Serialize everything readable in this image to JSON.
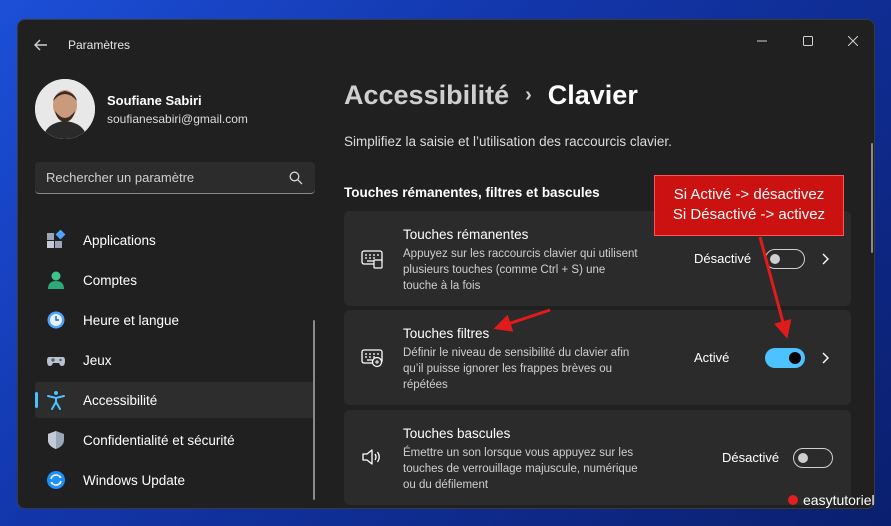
{
  "window": {
    "title": "Paramètres"
  },
  "user": {
    "name": "Soufiane Sabiri",
    "email": "soufianesabiri@gmail.com"
  },
  "search": {
    "placeholder": "Rechercher un paramètre"
  },
  "sidebar": {
    "items": [
      {
        "label": "Applications",
        "icon": "apps-icon"
      },
      {
        "label": "Comptes",
        "icon": "accounts-icon"
      },
      {
        "label": "Heure et langue",
        "icon": "time-language-icon"
      },
      {
        "label": "Jeux",
        "icon": "gamepad-icon"
      },
      {
        "label": "Accessibilité",
        "icon": "accessibility-icon",
        "active": true
      },
      {
        "label": "Confidentialité et sécurité",
        "icon": "shield-icon"
      },
      {
        "label": "Windows Update",
        "icon": "windows-update-icon"
      }
    ]
  },
  "breadcrumb": {
    "parent": "Accessibilité",
    "separator": "›",
    "current": "Clavier"
  },
  "page": {
    "subtitle": "Simplifiez la saisie et l’utilisation des raccourcis clavier.",
    "section_title": "Touches rémanentes, filtres et bascules"
  },
  "cards": [
    {
      "title": "Touches rémanentes",
      "description": "Appuyez sur les raccourcis clavier qui utilisent plusieurs touches (comme Ctrl + S) une touche à la fois",
      "state": "Désactivé",
      "on": false
    },
    {
      "title": "Touches filtres",
      "description": "Définir le niveau de sensibilité du clavier afin qu’il puisse ignorer les frappes brèves ou répétées",
      "state": "Activé",
      "on": true
    },
    {
      "title": "Touches bascules",
      "description": "Émettre un son lorsque vous appuyez sur les touches de verrouillage majuscule, numérique ou du défilement",
      "state": "Désactivé",
      "on": false
    }
  ],
  "callout": {
    "line1": "Si Activé -> désactivez",
    "line2": "Si Désactivé -> activez"
  },
  "watermark": {
    "text": "easytutoriel"
  },
  "colors": {
    "accent": "#4cc2ff",
    "callout": "#cc1111",
    "window_bg": "#202020",
    "card_bg": "#2b2b2b"
  }
}
